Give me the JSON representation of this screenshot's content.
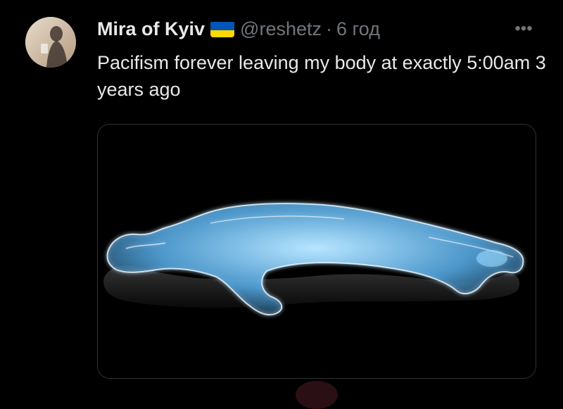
{
  "tweet": {
    "author_name": "Mira of Kyiv",
    "flag_icon": "ukraine-flag-icon",
    "handle": "@reshetz",
    "separator": "·",
    "timestamp": "6 год",
    "more_icon": "more-dots-icon",
    "more_label": "•••",
    "text": "Pacifism forever leaving my body at exactly 5:00am 3 years ago"
  },
  "colors": {
    "background": "#000000",
    "text_primary": "#e7e9ea",
    "text_secondary": "#71767b",
    "media_border": "#2f3336",
    "flag_blue": "#0057b7",
    "flag_yellow": "#ffd700",
    "glow": "#8fd3ff"
  }
}
